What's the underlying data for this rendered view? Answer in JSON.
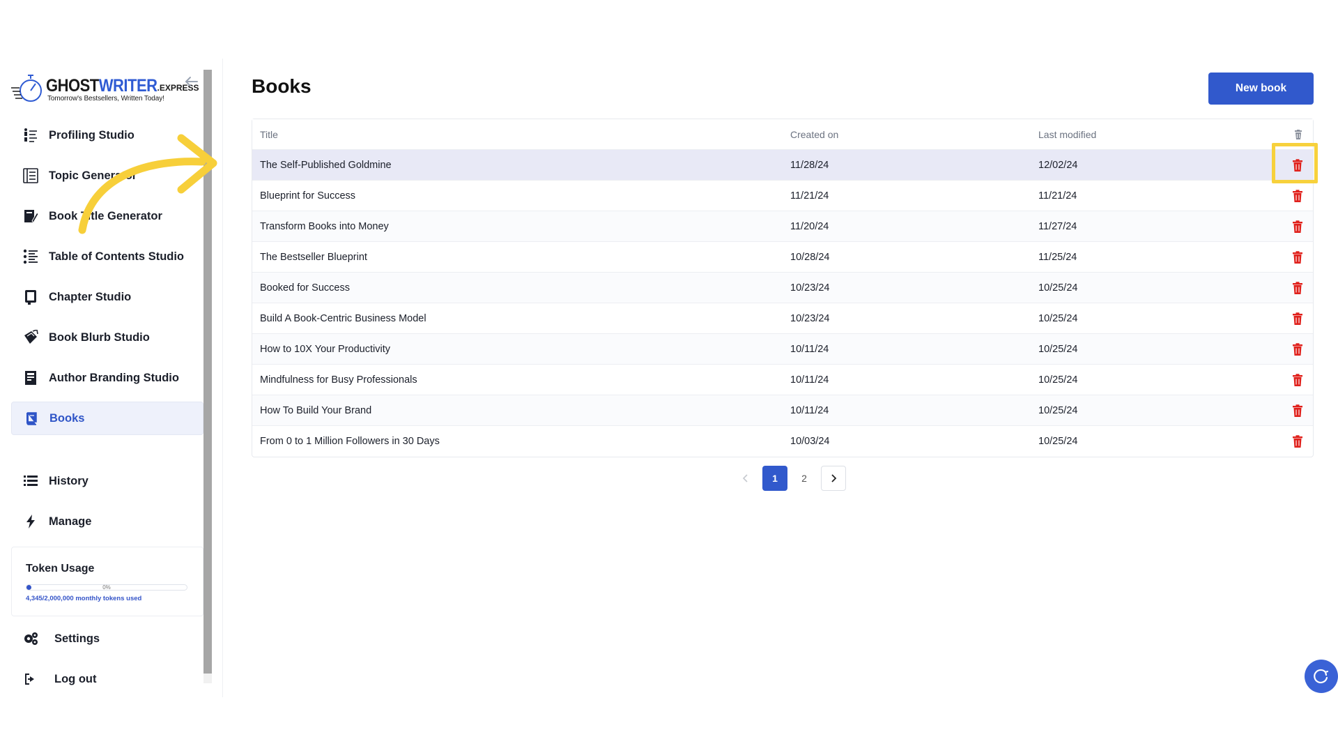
{
  "brand": {
    "name_part1": "GHOST",
    "name_part2": "WRITER",
    "name_ext": ".EXPRESS",
    "tagline": "Tomorrow's Bestsellers, Written Today!"
  },
  "sidebar": {
    "items": [
      {
        "label": "Profiling Studio",
        "icon": "profiling-icon"
      },
      {
        "label": "Topic Generator",
        "icon": "topic-list-icon"
      },
      {
        "label": "Book Title Generator",
        "icon": "book-edit-icon"
      },
      {
        "label": "Table of Contents Studio",
        "icon": "toc-icon"
      },
      {
        "label": "Chapter Studio",
        "icon": "chapter-icon"
      },
      {
        "label": "Book Blurb Studio",
        "icon": "blurb-icon"
      },
      {
        "label": "Author Branding Studio",
        "icon": "branding-icon"
      },
      {
        "label": "Books",
        "icon": "book-icon",
        "active": true
      }
    ],
    "secondary": [
      {
        "label": "History",
        "icon": "list-icon"
      },
      {
        "label": "Manage",
        "icon": "bolt-icon"
      }
    ],
    "token_usage": {
      "title": "Token Usage",
      "percent_label": "0%",
      "fill_fraction": 0.03,
      "detail": "4,345/2,000,000 monthly tokens used"
    },
    "footer": [
      {
        "label": "Settings",
        "icon": "gears-icon"
      },
      {
        "label": "Log out",
        "icon": "logout-icon"
      }
    ]
  },
  "main": {
    "title": "Books",
    "new_button": "New book",
    "table": {
      "headers": {
        "title": "Title",
        "created": "Created on",
        "modified": "Last modified"
      },
      "rows": [
        {
          "title": "The Self-Published Goldmine",
          "created": "11/28/24",
          "modified": "12/02/24"
        },
        {
          "title": "Blueprint for Success",
          "created": "11/21/24",
          "modified": "11/21/24"
        },
        {
          "title": "Transform Books into Money",
          "created": "11/20/24",
          "modified": "11/27/24"
        },
        {
          "title": "The Bestseller Blueprint",
          "created": "10/28/24",
          "modified": "11/25/24"
        },
        {
          "title": "Booked for Success",
          "created": "10/23/24",
          "modified": "10/25/24"
        },
        {
          "title": "Build A Book-Centric Business Model",
          "created": "10/23/24",
          "modified": "10/25/24"
        },
        {
          "title": "How to 10X Your Productivity",
          "created": "10/11/24",
          "modified": "10/25/24"
        },
        {
          "title": "Mindfulness for Busy Professionals",
          "created": "10/11/24",
          "modified": "10/25/24"
        },
        {
          "title": "How To Build Your Brand",
          "created": "10/11/24",
          "modified": "10/25/24"
        },
        {
          "title": "From 0 to 1 Million Followers in 30 Days",
          "created": "10/03/24",
          "modified": "10/25/24"
        }
      ]
    },
    "pagination": {
      "pages": [
        "1",
        "2"
      ],
      "current": "1"
    }
  },
  "colors": {
    "accent": "#3159cc",
    "delete": "#e0201b",
    "highlight": "#f7d13c",
    "annotation_arrow": "#f7cf3a"
  }
}
